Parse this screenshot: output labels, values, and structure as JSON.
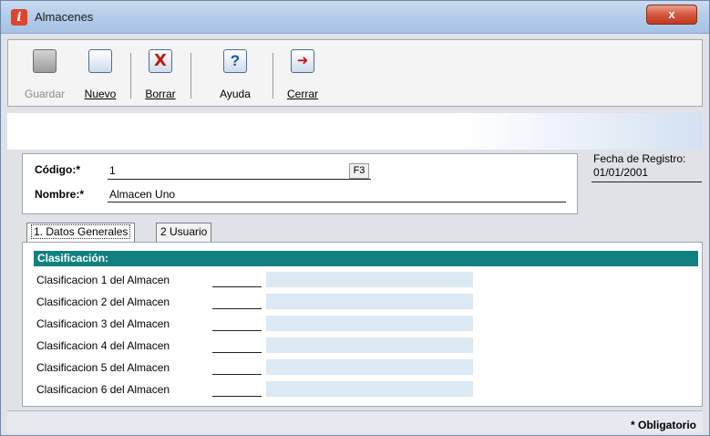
{
  "window": {
    "title": "Almacenes",
    "close_label": "x"
  },
  "toolbar": {
    "buttons": [
      {
        "label": "Guardar",
        "icon": "save-icon",
        "enabled": false
      },
      {
        "label": "Nuevo",
        "icon": "new-document-icon",
        "enabled": true
      },
      {
        "label": "Borrar",
        "icon": "delete-icon",
        "enabled": true
      },
      {
        "label": "Ayuda",
        "icon": "help-icon",
        "enabled": true
      },
      {
        "label": "Cerrar",
        "icon": "exit-icon",
        "enabled": true
      }
    ]
  },
  "header": {
    "codigo_label": "Código:*",
    "codigo_value": "1",
    "codigo_shortcut": "F3",
    "nombre_label": "Nombre:*",
    "nombre_value": "Almacen Uno",
    "fecha_label": "Fecha de Registro:",
    "fecha_value": "01/01/2001"
  },
  "tabs": [
    {
      "label": "1. Datos Generales",
      "active": true
    },
    {
      "label": "2 Usuario",
      "active": false
    }
  ],
  "clasificacion": {
    "title": "Clasificación:",
    "rows": [
      {
        "label": "Clasificacion 1 del Almacen",
        "value": "",
        "description": ""
      },
      {
        "label": "Clasificacion 2 del Almacen",
        "value": "",
        "description": ""
      },
      {
        "label": "Clasificacion 3 del Almacen",
        "value": "",
        "description": ""
      },
      {
        "label": "Clasificacion 4 del Almacen",
        "value": "",
        "description": ""
      },
      {
        "label": "Clasificacion 5 del Almacen",
        "value": "",
        "description": ""
      },
      {
        "label": "Clasificacion 6 del Almacen",
        "value": "",
        "description": ""
      }
    ]
  },
  "footer": {
    "required_note": "* Obligatorio"
  },
  "colors": {
    "section_header": "#138080",
    "title_bar": "#b4cde9",
    "close_button": "#d4573c"
  }
}
